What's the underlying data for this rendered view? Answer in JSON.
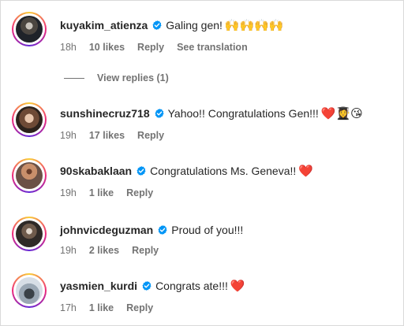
{
  "comments": [
    {
      "username": "kuyakim_atienza",
      "text": "Galing gen!",
      "emojis": "🙌🙌🙌🙌",
      "time": "18h",
      "likes": "10 likes",
      "reply": "Reply",
      "see_translation": "See translation"
    },
    {
      "username": "sunshinecruz718",
      "text": "Yahoo!! Congratulations Gen!!!",
      "emojis": "❤️👩‍🎓😘",
      "time": "19h",
      "likes": "17 likes",
      "reply": "Reply"
    },
    {
      "username": "90skabaklaan",
      "text": "Congratulations Ms. Geneva!!",
      "emojis": "❤️",
      "time": "19h",
      "likes": "1 like",
      "reply": "Reply"
    },
    {
      "username": "johnvicdeguzman",
      "text": "Proud of you!!!",
      "emojis": "",
      "time": "19h",
      "likes": "2 likes",
      "reply": "Reply"
    },
    {
      "username": "yasmien_kurdi",
      "text": "Congrats ate!!!",
      "emojis": "❤️",
      "time": "17h",
      "likes": "1 like",
      "reply": "Reply"
    }
  ],
  "view_replies": "View replies (1)",
  "colors": {
    "verified": "#0095f6",
    "meta_text": "#737373",
    "text": "#262626"
  },
  "icons": {
    "verified": "verified-badge-icon"
  }
}
